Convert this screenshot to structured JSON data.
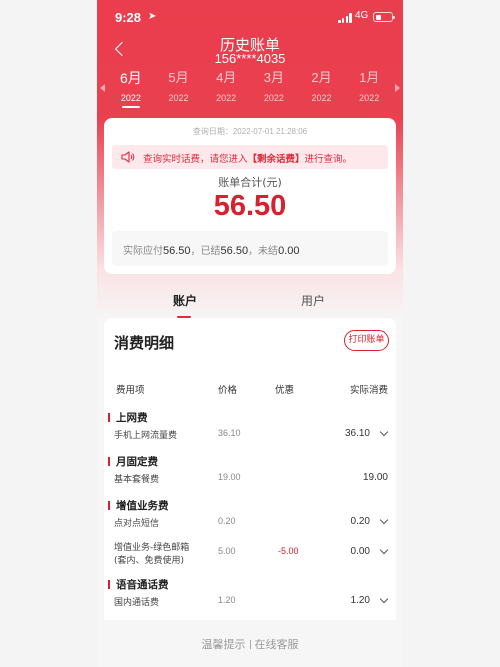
{
  "status_bar": {
    "time": "9:28",
    "network": "4G"
  },
  "header": {
    "title": "历史账单",
    "phone": "156****4035"
  },
  "months": [
    {
      "month": "6月",
      "year": "2022"
    },
    {
      "month": "5月",
      "year": "2022"
    },
    {
      "month": "4月",
      "year": "2022"
    },
    {
      "month": "3月",
      "year": "2022"
    },
    {
      "month": "2月",
      "year": "2022"
    },
    {
      "month": "1月",
      "year": "2022"
    }
  ],
  "summary": {
    "query_date": "查询日期：2022-07-01 21:28:06",
    "notice_prefix": "查询实时话费，请您进入",
    "notice_highlight": "【剩余话费】",
    "notice_suffix": "进行查询。",
    "total_label": "账单合计(元)",
    "total": "56.50",
    "payable_label": "实际应付",
    "payable": "56.50",
    "settled_label": "，已结",
    "settled": "56.50",
    "unsettled_label": "，未结",
    "unsettled": "0.00"
  },
  "tabs": [
    {
      "label": "账户"
    },
    {
      "label": "用户"
    }
  ],
  "details": {
    "title": "消费明细",
    "print_label": "打印账单",
    "columns": {
      "item": "费用项",
      "price": "价格",
      "discount": "优惠",
      "actual": "实际消费"
    },
    "sections": [
      {
        "title": "上网费",
        "rows": [
          {
            "name": "手机上网流量费",
            "price": "36.10",
            "discount": "",
            "actual": "36.10"
          }
        ]
      },
      {
        "title": "月固定费",
        "rows": [
          {
            "name": "基本套餐费",
            "price": "19.00",
            "discount": "",
            "actual": "19.00"
          }
        ]
      },
      {
        "title": "增值业务费",
        "rows": [
          {
            "name": "点对点短信",
            "price": "0.20",
            "discount": "",
            "actual": "0.20"
          },
          {
            "name": "增值业务-绿色邮箱",
            "name2": "(套内、免费使用)",
            "price": "5.00",
            "discount": "-5.00",
            "actual": "0.00"
          }
        ]
      },
      {
        "title": "语音通话费",
        "rows": [
          {
            "name": "国内通话费",
            "price": "1.20",
            "discount": "",
            "actual": "1.20"
          }
        ]
      }
    ]
  },
  "footer": {
    "tip": "温馨提示",
    "service": "在线客服"
  }
}
